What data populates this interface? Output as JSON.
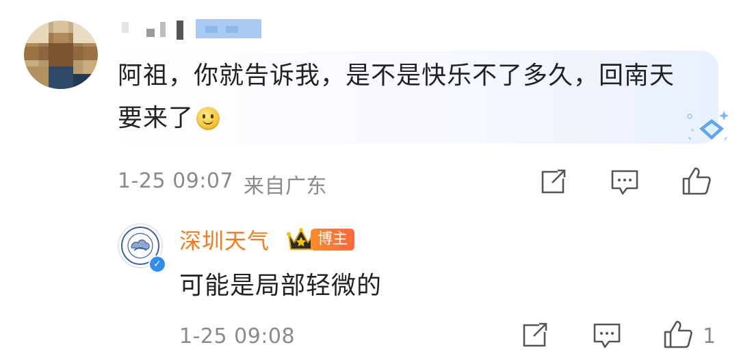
{
  "comment": {
    "text": "阿祖，你就告诉我，是不是快乐不了多久，回南天要来了",
    "time": "1-25 09:07",
    "location": "来自广东",
    "icons": [
      "share-icon",
      "comment-icon",
      "like-icon"
    ]
  },
  "reply": {
    "author": "深圳天气",
    "badge": "博主",
    "text": "可能是局部轻微的",
    "time": "1-25 09:08",
    "like_count": "1",
    "icons": [
      "share-icon",
      "comment-icon",
      "like-icon"
    ]
  },
  "colors": {
    "author_name": "#f27c1f",
    "meta_gray": "#8a8a8a",
    "verified_blue": "#2f8df0",
    "badge_orange": "#ff7a30"
  }
}
